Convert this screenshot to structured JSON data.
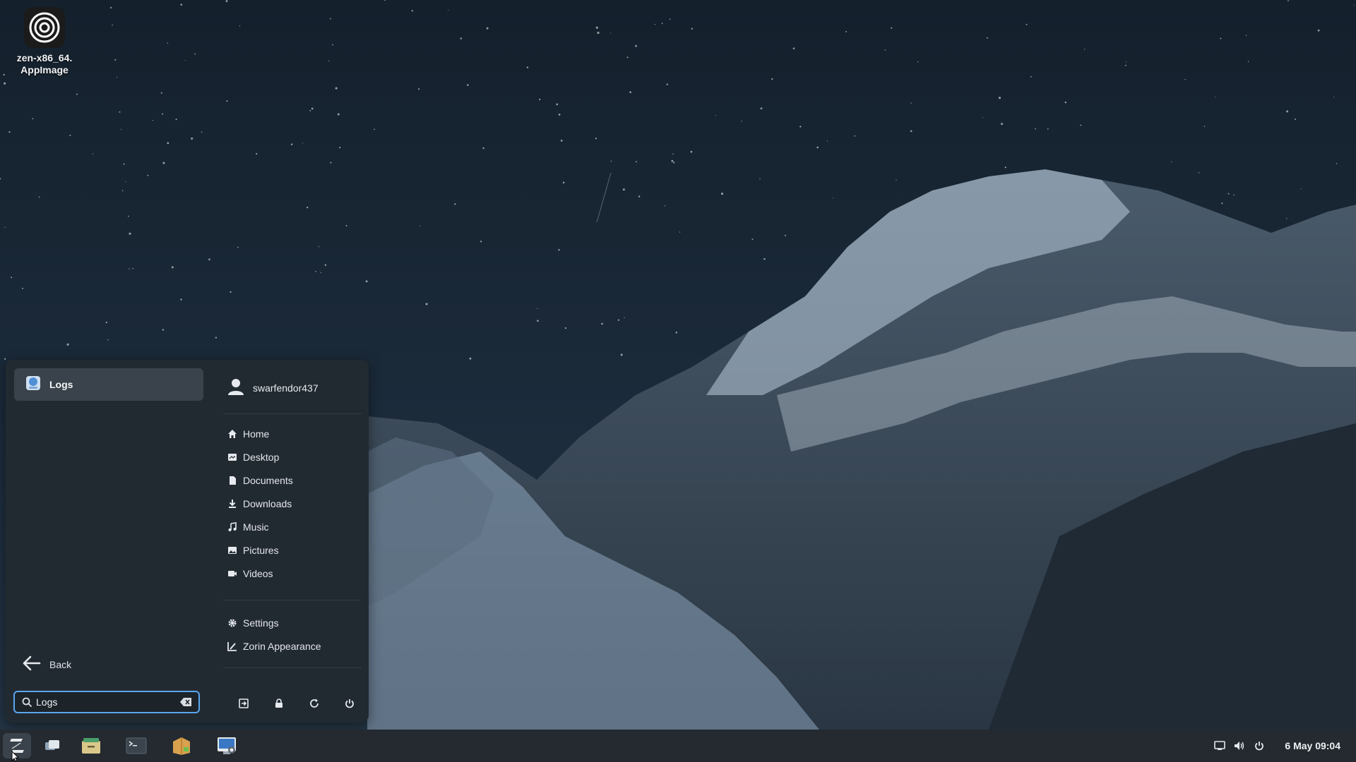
{
  "desktop": {
    "icon_label_line1": "zen-x86_64.",
    "icon_label_line2": "AppImage"
  },
  "menu": {
    "result": {
      "label": "Logs",
      "icon": "logs-app-icon"
    },
    "back_label": "Back",
    "search": {
      "value": "Logs",
      "placeholder": ""
    },
    "user": {
      "name": "swarfendor437",
      "icon": "user-icon"
    },
    "places": [
      {
        "label": "Home",
        "icon": "home-icon"
      },
      {
        "label": "Desktop",
        "icon": "desktop-folder-icon"
      },
      {
        "label": "Documents",
        "icon": "documents-icon"
      },
      {
        "label": "Downloads",
        "icon": "downloads-icon"
      },
      {
        "label": "Music",
        "icon": "music-icon"
      },
      {
        "label": "Pictures",
        "icon": "pictures-icon"
      },
      {
        "label": "Videos",
        "icon": "videos-icon"
      }
    ],
    "system": [
      {
        "label": "Settings",
        "icon": "gear-icon"
      },
      {
        "label": "Zorin Appearance",
        "icon": "appearance-icon"
      }
    ],
    "power_buttons": [
      "logout-icon",
      "lock-icon",
      "restart-icon",
      "power-icon"
    ]
  },
  "taskbar": {
    "apps": [
      "zorin-menu-icon",
      "workspaces-icon",
      "files-icon",
      "terminal-icon",
      "software-store-icon",
      "screenshot-tool-icon"
    ],
    "tray": [
      "display-icon",
      "volume-icon",
      "power-icon"
    ],
    "clock": "6 May  09:04"
  },
  "colors": {
    "accent": "#5aa6f0",
    "menu_bg": "#222a31",
    "taskbar_bg": "#242a30",
    "selection_bg": "#3a434b"
  }
}
